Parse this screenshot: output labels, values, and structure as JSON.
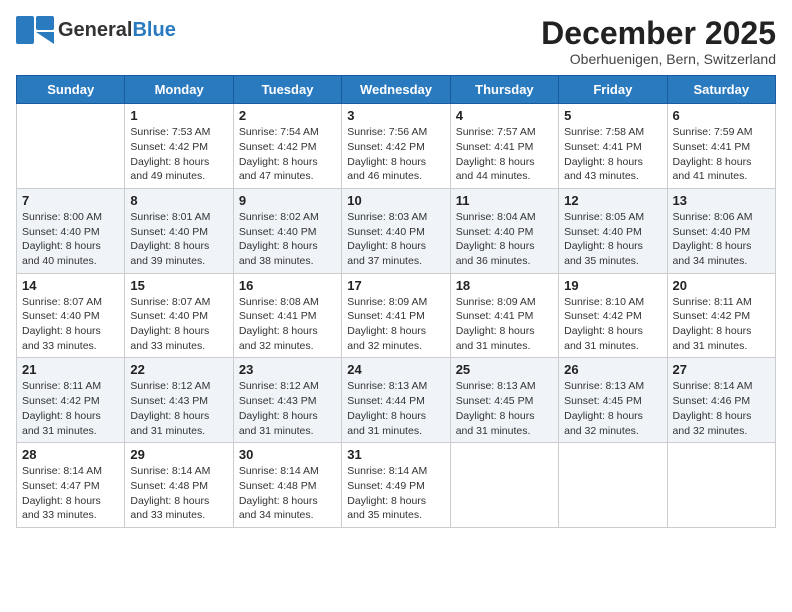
{
  "header": {
    "logo_general": "General",
    "logo_blue": "Blue",
    "month_title": "December 2025",
    "location": "Oberhuenigen, Bern, Switzerland"
  },
  "weekdays": [
    "Sunday",
    "Monday",
    "Tuesday",
    "Wednesday",
    "Thursday",
    "Friday",
    "Saturday"
  ],
  "weeks": [
    [
      {
        "day": "",
        "sunrise": "",
        "sunset": "",
        "daylight": ""
      },
      {
        "day": "1",
        "sunrise": "Sunrise: 7:53 AM",
        "sunset": "Sunset: 4:42 PM",
        "daylight": "Daylight: 8 hours and 49 minutes."
      },
      {
        "day": "2",
        "sunrise": "Sunrise: 7:54 AM",
        "sunset": "Sunset: 4:42 PM",
        "daylight": "Daylight: 8 hours and 47 minutes."
      },
      {
        "day": "3",
        "sunrise": "Sunrise: 7:56 AM",
        "sunset": "Sunset: 4:42 PM",
        "daylight": "Daylight: 8 hours and 46 minutes."
      },
      {
        "day": "4",
        "sunrise": "Sunrise: 7:57 AM",
        "sunset": "Sunset: 4:41 PM",
        "daylight": "Daylight: 8 hours and 44 minutes."
      },
      {
        "day": "5",
        "sunrise": "Sunrise: 7:58 AM",
        "sunset": "Sunset: 4:41 PM",
        "daylight": "Daylight: 8 hours and 43 minutes."
      },
      {
        "day": "6",
        "sunrise": "Sunrise: 7:59 AM",
        "sunset": "Sunset: 4:41 PM",
        "daylight": "Daylight: 8 hours and 41 minutes."
      }
    ],
    [
      {
        "day": "7",
        "sunrise": "Sunrise: 8:00 AM",
        "sunset": "Sunset: 4:40 PM",
        "daylight": "Daylight: 8 hours and 40 minutes."
      },
      {
        "day": "8",
        "sunrise": "Sunrise: 8:01 AM",
        "sunset": "Sunset: 4:40 PM",
        "daylight": "Daylight: 8 hours and 39 minutes."
      },
      {
        "day": "9",
        "sunrise": "Sunrise: 8:02 AM",
        "sunset": "Sunset: 4:40 PM",
        "daylight": "Daylight: 8 hours and 38 minutes."
      },
      {
        "day": "10",
        "sunrise": "Sunrise: 8:03 AM",
        "sunset": "Sunset: 4:40 PM",
        "daylight": "Daylight: 8 hours and 37 minutes."
      },
      {
        "day": "11",
        "sunrise": "Sunrise: 8:04 AM",
        "sunset": "Sunset: 4:40 PM",
        "daylight": "Daylight: 8 hours and 36 minutes."
      },
      {
        "day": "12",
        "sunrise": "Sunrise: 8:05 AM",
        "sunset": "Sunset: 4:40 PM",
        "daylight": "Daylight: 8 hours and 35 minutes."
      },
      {
        "day": "13",
        "sunrise": "Sunrise: 8:06 AM",
        "sunset": "Sunset: 4:40 PM",
        "daylight": "Daylight: 8 hours and 34 minutes."
      }
    ],
    [
      {
        "day": "14",
        "sunrise": "Sunrise: 8:07 AM",
        "sunset": "Sunset: 4:40 PM",
        "daylight": "Daylight: 8 hours and 33 minutes."
      },
      {
        "day": "15",
        "sunrise": "Sunrise: 8:07 AM",
        "sunset": "Sunset: 4:40 PM",
        "daylight": "Daylight: 8 hours and 33 minutes."
      },
      {
        "day": "16",
        "sunrise": "Sunrise: 8:08 AM",
        "sunset": "Sunset: 4:41 PM",
        "daylight": "Daylight: 8 hours and 32 minutes."
      },
      {
        "day": "17",
        "sunrise": "Sunrise: 8:09 AM",
        "sunset": "Sunset: 4:41 PM",
        "daylight": "Daylight: 8 hours and 32 minutes."
      },
      {
        "day": "18",
        "sunrise": "Sunrise: 8:09 AM",
        "sunset": "Sunset: 4:41 PM",
        "daylight": "Daylight: 8 hours and 31 minutes."
      },
      {
        "day": "19",
        "sunrise": "Sunrise: 8:10 AM",
        "sunset": "Sunset: 4:42 PM",
        "daylight": "Daylight: 8 hours and 31 minutes."
      },
      {
        "day": "20",
        "sunrise": "Sunrise: 8:11 AM",
        "sunset": "Sunset: 4:42 PM",
        "daylight": "Daylight: 8 hours and 31 minutes."
      }
    ],
    [
      {
        "day": "21",
        "sunrise": "Sunrise: 8:11 AM",
        "sunset": "Sunset: 4:42 PM",
        "daylight": "Daylight: 8 hours and 31 minutes."
      },
      {
        "day": "22",
        "sunrise": "Sunrise: 8:12 AM",
        "sunset": "Sunset: 4:43 PM",
        "daylight": "Daylight: 8 hours and 31 minutes."
      },
      {
        "day": "23",
        "sunrise": "Sunrise: 8:12 AM",
        "sunset": "Sunset: 4:43 PM",
        "daylight": "Daylight: 8 hours and 31 minutes."
      },
      {
        "day": "24",
        "sunrise": "Sunrise: 8:13 AM",
        "sunset": "Sunset: 4:44 PM",
        "daylight": "Daylight: 8 hours and 31 minutes."
      },
      {
        "day": "25",
        "sunrise": "Sunrise: 8:13 AM",
        "sunset": "Sunset: 4:45 PM",
        "daylight": "Daylight: 8 hours and 31 minutes."
      },
      {
        "day": "26",
        "sunrise": "Sunrise: 8:13 AM",
        "sunset": "Sunset: 4:45 PM",
        "daylight": "Daylight: 8 hours and 32 minutes."
      },
      {
        "day": "27",
        "sunrise": "Sunrise: 8:14 AM",
        "sunset": "Sunset: 4:46 PM",
        "daylight": "Daylight: 8 hours and 32 minutes."
      }
    ],
    [
      {
        "day": "28",
        "sunrise": "Sunrise: 8:14 AM",
        "sunset": "Sunset: 4:47 PM",
        "daylight": "Daylight: 8 hours and 33 minutes."
      },
      {
        "day": "29",
        "sunrise": "Sunrise: 8:14 AM",
        "sunset": "Sunset: 4:48 PM",
        "daylight": "Daylight: 8 hours and 33 minutes."
      },
      {
        "day": "30",
        "sunrise": "Sunrise: 8:14 AM",
        "sunset": "Sunset: 4:48 PM",
        "daylight": "Daylight: 8 hours and 34 minutes."
      },
      {
        "day": "31",
        "sunrise": "Sunrise: 8:14 AM",
        "sunset": "Sunset: 4:49 PM",
        "daylight": "Daylight: 8 hours and 35 minutes."
      },
      {
        "day": "",
        "sunrise": "",
        "sunset": "",
        "daylight": ""
      },
      {
        "day": "",
        "sunrise": "",
        "sunset": "",
        "daylight": ""
      },
      {
        "day": "",
        "sunrise": "",
        "sunset": "",
        "daylight": ""
      }
    ]
  ]
}
